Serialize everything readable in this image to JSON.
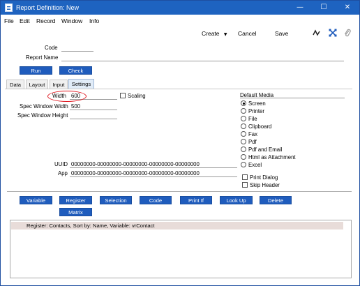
{
  "window": {
    "title": "Report Definition: New",
    "minimize": "—",
    "maximize": "☐",
    "close": "✕"
  },
  "menu": [
    "File",
    "Edit",
    "Record",
    "Window",
    "Info"
  ],
  "toolbar": {
    "create": "Create",
    "create_arrow": "▼",
    "cancel": "Cancel",
    "save": "Save"
  },
  "header": {
    "code_label": "Code",
    "code_value": "",
    "report_name_label": "Report Name",
    "report_name_value": "",
    "run_button": "Run",
    "check_button": "Check"
  },
  "tabs": [
    "Data",
    "Layout",
    "Input",
    "Settings"
  ],
  "active_tab": "Settings",
  "settings": {
    "width_label": "Width",
    "width_value": "600",
    "scaling_label": "Scaling",
    "spec_window_width_label": "Spec Window Width",
    "spec_window_width_value": "500",
    "spec_window_height_label": "Spec Window Height",
    "spec_window_height_value": "",
    "uuid_label": "UUID",
    "uuid_value": "00000000-00000000-00000000-00000000-00000000",
    "app_label": "App",
    "app_value": "00000000-00000000-00000000-00000000-00000000"
  },
  "default_media": {
    "label": "Default Media",
    "options": [
      "Screen",
      "Printer",
      "File",
      "Clipboard",
      "Fax",
      "Pdf",
      "Pdf and Email",
      "Html as Attachment",
      "Excel"
    ],
    "selected": "Screen"
  },
  "options": {
    "print_dialog": "Print Dialog",
    "skip_header": "Skip Header"
  },
  "actions": [
    "Variable",
    "Register",
    "Selection",
    "Code",
    "Print If",
    "Look Up",
    "Delete",
    "Matrix"
  ],
  "list": {
    "rows": [
      "Register: Contacts, Sort by: Name, Variable: vrContact"
    ]
  }
}
